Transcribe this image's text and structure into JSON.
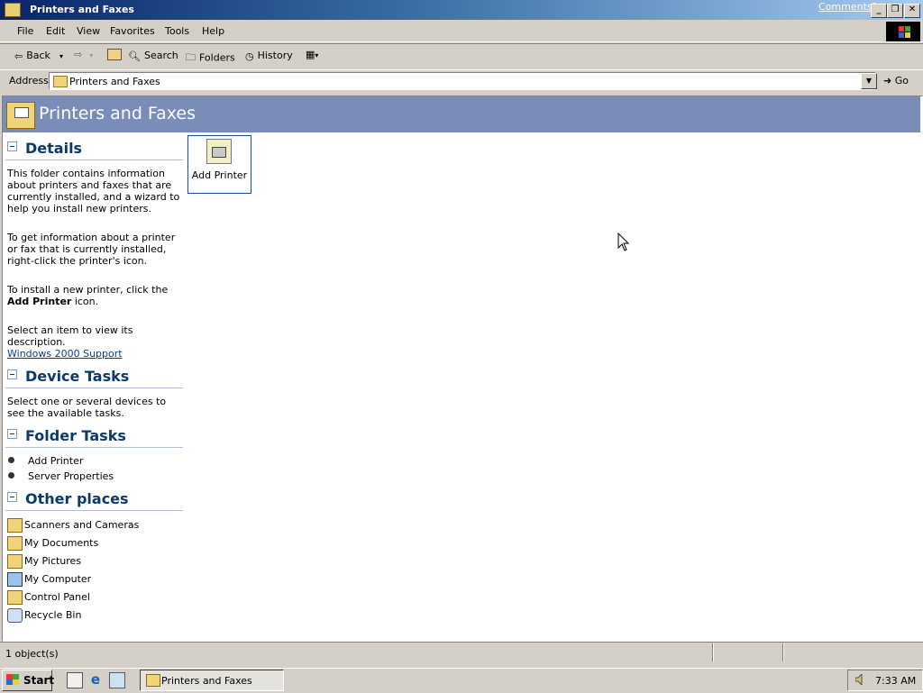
{
  "window": {
    "title": "Printers and Faxes",
    "comments_link": "Comments?"
  },
  "menu": [
    "File",
    "Edit",
    "View",
    "Favorites",
    "Tools",
    "Help"
  ],
  "toolbar": {
    "back": "Back",
    "search": "Search",
    "folders": "Folders",
    "history": "History"
  },
  "address": {
    "label": "Address",
    "value": "Printers and Faxes",
    "go": "Go"
  },
  "banner": {
    "title": "Printers and Faxes"
  },
  "details": {
    "header": "Details",
    "p1": "This folder contains information about printers and faxes that are currently installed, and a wizard to help you install new printers.",
    "p2": "To get information about a printer or fax that is currently installed, right-click the printer's icon.",
    "p3_pre": "To install a new printer, click the ",
    "p3_bold": "Add Printer",
    "p3_post": " icon.",
    "p4": "Select an item to view its description.",
    "support_link": "Windows 2000 Support"
  },
  "device_tasks": {
    "header": "Device Tasks",
    "text": "Select one or several devices to see the available tasks."
  },
  "folder_tasks": {
    "header": "Folder Tasks",
    "items": [
      "Add Printer",
      "Server Properties"
    ]
  },
  "other_places": {
    "header": "Other places",
    "items": [
      "Scanners and Cameras",
      "My Documents",
      "My Pictures",
      "My Computer",
      "Control Panel",
      "Recycle Bin"
    ]
  },
  "content": {
    "items": [
      "Add Printer"
    ]
  },
  "status": {
    "text": "1 object(s)"
  },
  "taskbar": {
    "start": "Start",
    "task": "Printers and Faxes",
    "clock": "7:33 AM"
  },
  "colors": {
    "banner": "#7a8cb8",
    "title_bar": "#0a246a",
    "header_text": "#0b3a6b"
  }
}
